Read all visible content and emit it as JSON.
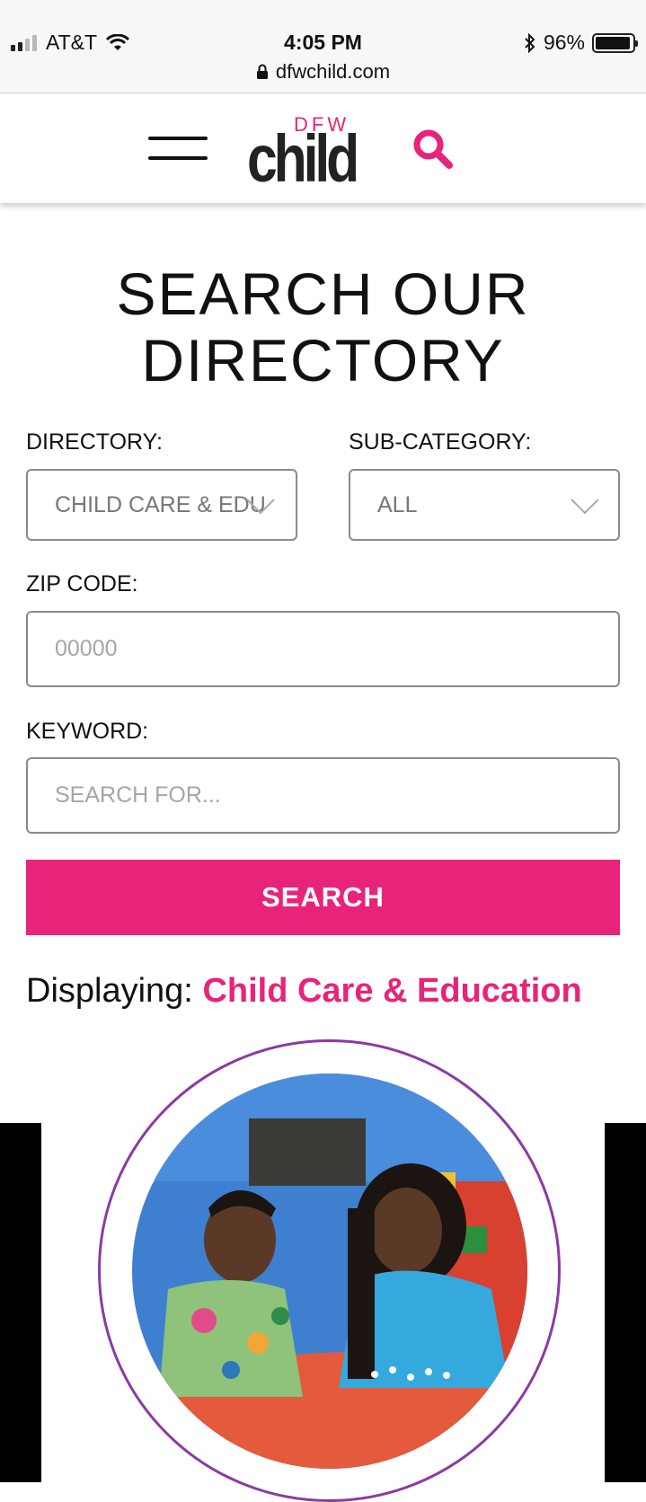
{
  "status": {
    "carrier": "AT&T",
    "time": "4:05 PM",
    "url": "dfwchild.com",
    "battery": "96%",
    "battery_level": 0.96
  },
  "logo": {
    "top": "DFW",
    "main": "child"
  },
  "page_title_line1": "SEARCH OUR",
  "page_title_line2": "DIRECTORY",
  "form": {
    "directory_label": "DIRECTORY:",
    "directory_value": "CHILD CARE & EDU",
    "subcategory_label": "SUB-CATEGORY:",
    "subcategory_value": "ALL",
    "zip_label": "ZIP CODE:",
    "zip_placeholder": "00000",
    "keyword_label": "KEYWORD:",
    "keyword_placeholder": "SEARCH FOR...",
    "search_button": "SEARCH"
  },
  "results": {
    "displaying_label": "Displaying:",
    "displaying_value": "Child Care & Education"
  },
  "colors": {
    "accent": "#e8237a",
    "ring": "#8b3aa3"
  }
}
